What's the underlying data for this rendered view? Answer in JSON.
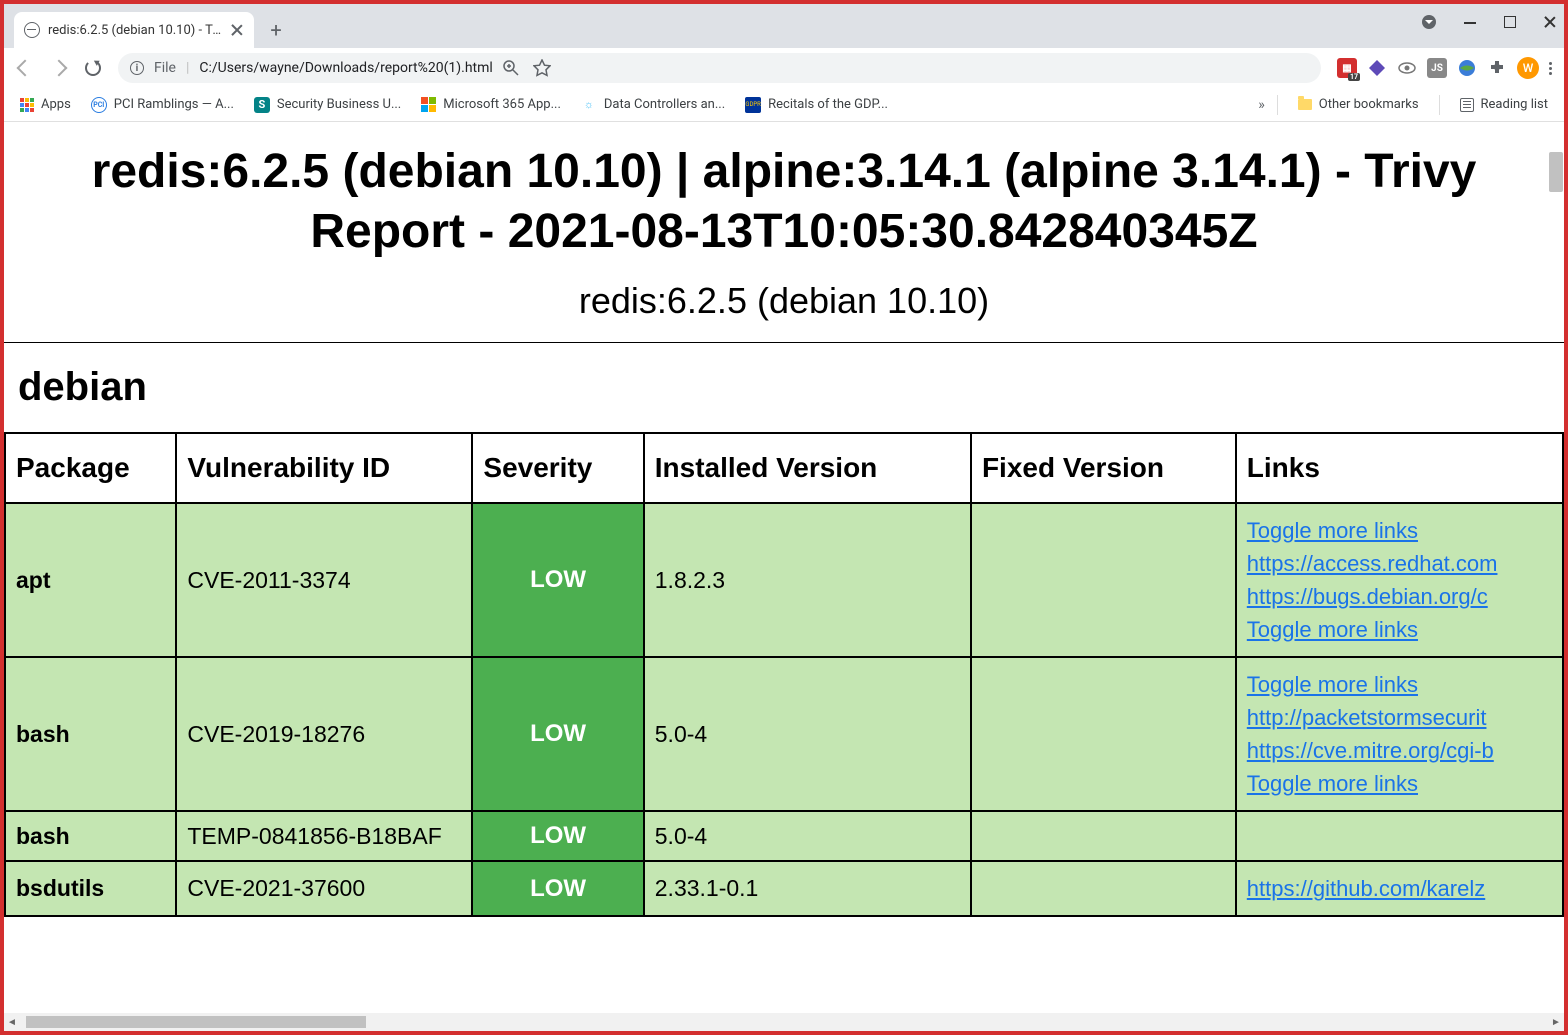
{
  "browser": {
    "tab_title": "redis:6.2.5 (debian 10.10) - Trivy R",
    "url_prefix": "File",
    "url_path": "C:/Users/wayne/Downloads/report%20(1).html",
    "avatar_letter": "W"
  },
  "bookmarks": {
    "apps": "Apps",
    "items": [
      "PCI Ramblings — A...",
      "Security Business U...",
      "Microsoft 365 App...",
      "Data Controllers an...",
      "Recitals of the GDP..."
    ],
    "overflow": "»",
    "other": "Other bookmarks",
    "reading": "Reading list"
  },
  "report": {
    "title": "redis:6.2.5 (debian 10.10) | alpine:3.14.1 (alpine 3.14.1) - Trivy Report - 2021-08-13T10:05:30.842840345Z",
    "subtitle": "redis:6.2.5 (debian 10.10)",
    "section": "debian",
    "columns": {
      "package": "Package",
      "vuln": "Vulnerability ID",
      "severity": "Severity",
      "installed": "Installed Version",
      "fixed": "Fixed Version",
      "links": "Links"
    },
    "rows": [
      {
        "package": "apt",
        "vuln": "CVE-2011-3374",
        "severity": "LOW",
        "installed": "1.8.2.3",
        "fixed": "",
        "links": [
          "Toggle more links",
          "https://access.redhat.com",
          "https://bugs.debian.org/c",
          "Toggle more links"
        ]
      },
      {
        "package": "bash",
        "vuln": "CVE-2019-18276",
        "severity": "LOW",
        "installed": "5.0-4",
        "fixed": "",
        "links": [
          "Toggle more links",
          "http://packetstormsecurit",
          "https://cve.mitre.org/cgi-b",
          "Toggle more links"
        ]
      },
      {
        "package": "bash",
        "vuln": "TEMP-0841856-B18BAF",
        "severity": "LOW",
        "installed": "5.0-4",
        "fixed": "",
        "links": []
      },
      {
        "package": "bsdutils",
        "vuln": "CVE-2021-37600",
        "severity": "LOW",
        "installed": "2.33.1-0.1",
        "fixed": "",
        "links": [
          "https://github.com/karelz"
        ]
      }
    ]
  }
}
